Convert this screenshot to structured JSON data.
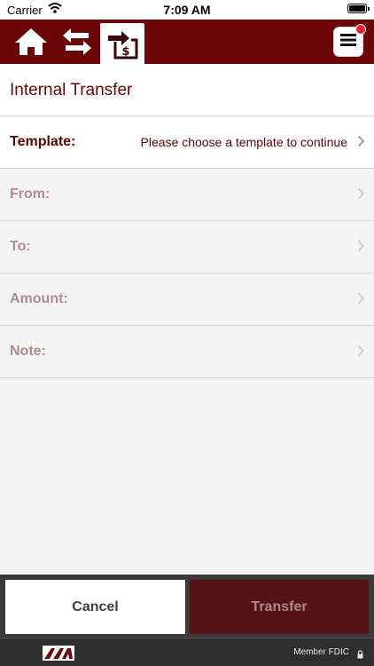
{
  "status_bar": {
    "carrier": "Carrier",
    "time": "7:09 AM"
  },
  "nav": {
    "icons": [
      "home-icon",
      "swap-arrows-icon",
      "transfer-money-icon",
      "menu-icon"
    ]
  },
  "page": {
    "title": "Internal Transfer"
  },
  "form": {
    "rows": [
      {
        "label": "Template:",
        "value": "Please choose a template to continue"
      },
      {
        "label": "From:",
        "value": ""
      },
      {
        "label": "To:",
        "value": ""
      },
      {
        "label": "Amount:",
        "value": ""
      },
      {
        "label": "Note:",
        "value": ""
      }
    ]
  },
  "buttons": {
    "cancel": "Cancel",
    "transfer": "Transfer"
  },
  "footer": {
    "fdic": "Member FDIC"
  },
  "colors": {
    "brand": "#6b0608",
    "transfer_button": "#561215",
    "bottom_bar": "#3a3a3a"
  }
}
